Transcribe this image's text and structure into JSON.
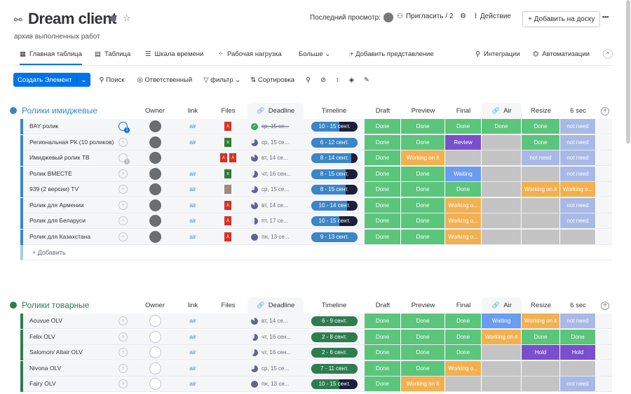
{
  "header": {
    "title": "Dream client",
    "subtitle": "архив выполненных работ",
    "last_view": "Последний просмотр:",
    "invite": "Пригласить / 2",
    "activity": "Действие",
    "add_to_board": "+ Добавить на доску",
    "more": "•••"
  },
  "tabs": [
    {
      "label": "Главная таблица"
    },
    {
      "label": "Таблица"
    },
    {
      "label": "Шкала времени"
    },
    {
      "label": "Рабочая нагрузка"
    },
    {
      "label": "Больше ⌄"
    },
    {
      "label": "+ Добавить представление"
    },
    {
      "label": "Интеграции"
    },
    {
      "label": "Автоматизации"
    }
  ],
  "toolbar": {
    "create": "Создать Элемент",
    "search": "Поиск",
    "person": "Ответственный",
    "filter": "фильтр",
    "sort": "Сортировка"
  },
  "columns": [
    "Owner",
    "link",
    "Files",
    "Deadline",
    "Timeline",
    "Draft",
    "Preview",
    "Final",
    "Air",
    "Resize",
    "6 sec"
  ],
  "status_colors": {
    "Done": "#5bc57b",
    "Working on it": "#f2b050",
    "Working o...": "#f2b050",
    "Review": "#7a4fcb",
    "Waiting": "#6a9cf0",
    "not need": "#a9b9e6",
    "Hold": "#7a4fcb",
    "": "#c4c4c4"
  },
  "groups": [
    {
      "title": "Ролики имиджевые",
      "color": "#3a86c8",
      "add_label": "+ Добавить",
      "items": [
        {
          "name": "BAY ролик",
          "comments": "1",
          "owner": true,
          "link": "air",
          "files": [
            "pdf"
          ],
          "deadline": "ср, 15 се...",
          "deadline_done": true,
          "deadline_progress": 1,
          "timeline": "10 - 15 сент.",
          "timeline_progress": 0.6,
          "statuses": [
            "Done",
            "Done",
            "Done",
            "Done",
            "Done",
            "not need"
          ]
        },
        {
          "name": "Региональная РК (10 роликов)",
          "comments": "",
          "owner": true,
          "link": "air",
          "files": [
            "xls"
          ],
          "deadline": "ср, 15 се...",
          "deadline_done": false,
          "deadline_progress": 0.7,
          "timeline": "6 - 12 сент.",
          "timeline_progress": 1,
          "statuses": [
            "Done",
            "Done",
            "Review",
            "",
            "Done",
            "not need"
          ]
        },
        {
          "name": "Имиджевый ролик ТВ",
          "comments": "1",
          "owner": true,
          "link": "",
          "files": [
            "pdf",
            "pdf"
          ],
          "deadline": "вт, 14 се...",
          "deadline_done": false,
          "deadline_progress": 0.85,
          "timeline": "8 - 14 сент.",
          "timeline_progress": 0.87,
          "statuses": [
            "Done",
            "Working on it",
            "",
            "",
            "not need",
            "not need"
          ]
        },
        {
          "name": "Ролик ВМЕСТЕ",
          "comments": "",
          "owner": true,
          "link": "air",
          "files": [
            "xls"
          ],
          "deadline": "чт, 16 сен...",
          "deadline_done": false,
          "deadline_progress": 0.6,
          "timeline": "8 - 15 сент.",
          "timeline_progress": 0.74,
          "statuses": [
            "Done",
            "Done",
            "Waiting",
            "",
            "",
            "not need"
          ]
        },
        {
          "name": "939 (2 версии) TV",
          "comments": "",
          "owner": true,
          "link": "air",
          "files": [
            "img"
          ],
          "deadline": "ср, 15 се...",
          "deadline_done": false,
          "deadline_progress": 0.7,
          "timeline": "8 - 15 сент.",
          "timeline_progress": 0.74,
          "statuses": [
            "Done",
            "Done",
            "Done",
            "",
            "Working on it",
            "Working o..."
          ]
        },
        {
          "name": "Ролик для Армении",
          "comments": "",
          "owner": true,
          "link": "air",
          "files": [
            "pdf"
          ],
          "deadline": "вт, 14 се...",
          "deadline_done": false,
          "deadline_progress": 0.85,
          "timeline": "10 - 14 сент.",
          "timeline_progress": 0.78,
          "statuses": [
            "Done",
            "Done",
            "Working o...",
            "",
            "",
            "not need"
          ]
        },
        {
          "name": "Ролик для Беларуси",
          "comments": "",
          "owner": true,
          "link": "air",
          "files": [
            "pdf"
          ],
          "deadline": "пт, 17 се...",
          "deadline_done": false,
          "deadline_progress": 0.5,
          "timeline": "10 - 15 сент.",
          "timeline_progress": 0.6,
          "statuses": [
            "Done",
            "Done",
            "Working o...",
            "",
            "",
            "not need"
          ]
        },
        {
          "name": "Ролик для Казахстана",
          "comments": "",
          "owner": true,
          "link": "air",
          "files": [
            "pdf"
          ],
          "deadline": "пн, 13 се...",
          "deadline_done": false,
          "deadline_progress": 1,
          "timeline": "9 - 13 сент.",
          "timeline_progress": 1,
          "statuses": [
            "Done",
            "Done",
            "Working o...",
            "",
            "",
            ""
          ]
        }
      ]
    },
    {
      "title": "Ролики товарные",
      "color": "#2e7d4f",
      "items": [
        {
          "name": "Acuvue OLV",
          "comments": "",
          "owner": false,
          "link": "air",
          "files": [],
          "deadline": "вт, 14 се...",
          "deadline_done": false,
          "deadline_progress": 0.85,
          "timeline": "6 - 9 сент.",
          "timeline_progress": 1,
          "statuses": [
            "Done",
            "Done",
            "Done",
            "Waiting",
            "Working on it",
            "not need"
          ]
        },
        {
          "name": "Felix OLV",
          "comments": "",
          "owner": false,
          "link": "air",
          "files": [],
          "deadline": "чт, 16 сен...",
          "deadline_done": false,
          "deadline_progress": 0.6,
          "timeline": "2 - 8 сент.",
          "timeline_progress": 1,
          "statuses": [
            "Done",
            "Done",
            "Done",
            "Working on it",
            "Done",
            "Done"
          ]
        },
        {
          "name": "Salomon/ Altair OLV",
          "comments": "",
          "owner": false,
          "link": "air",
          "files": [],
          "deadline": "чт, 16 сен...",
          "deadline_done": false,
          "deadline_progress": 0.6,
          "timeline": "2 - 6 сент.",
          "timeline_progress": 1,
          "statuses": [
            "Done",
            "Done",
            "Done",
            "",
            "Hold",
            "Hold"
          ]
        },
        {
          "name": "Nivona OLV",
          "comments": "",
          "owner": false,
          "link": "air",
          "files": [],
          "deadline": "ср, 15 се...",
          "deadline_done": false,
          "deadline_progress": 0.7,
          "timeline": "7 - 11 сент.",
          "timeline_progress": 1,
          "statuses": [
            "Done",
            "Done",
            "Working o...",
            "",
            "",
            ""
          ]
        },
        {
          "name": "Fairy OLV",
          "comments": "",
          "owner": false,
          "link": "air",
          "files": [],
          "deadline": "пн, 13 се...",
          "deadline_done": false,
          "deadline_progress": 1,
          "timeline": "10 - 15 сент.",
          "timeline_progress": 0.6,
          "statuses": [
            "Done",
            "Working on it",
            "",
            "",
            "",
            "not need"
          ]
        }
      ]
    }
  ]
}
